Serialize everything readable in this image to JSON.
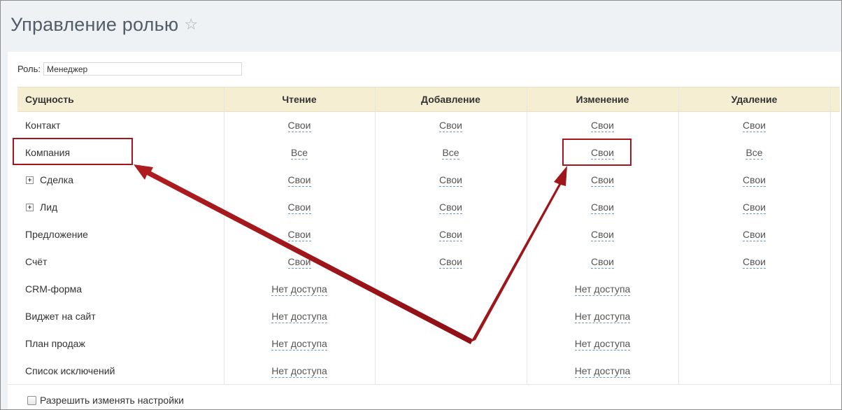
{
  "header": {
    "title": "Управление ролью"
  },
  "role": {
    "label": "Роль:",
    "value": "Менеджер"
  },
  "table": {
    "columns": [
      "Сущность",
      "Чтение",
      "Добавление",
      "Изменение",
      "Удаление"
    ],
    "rows": [
      {
        "entity": "Контакт",
        "expandable": false,
        "cells": [
          "Свои",
          "Свои",
          "Свои",
          "Свои"
        ]
      },
      {
        "entity": "Компания",
        "expandable": false,
        "cells": [
          "Все",
          "Все",
          "Свои",
          "Все"
        ]
      },
      {
        "entity": "Сделка",
        "expandable": true,
        "cells": [
          "Свои",
          "Свои",
          "Свои",
          "Свои"
        ]
      },
      {
        "entity": "Лид",
        "expandable": true,
        "cells": [
          "Свои",
          "Свои",
          "Свои",
          "Свои"
        ]
      },
      {
        "entity": "Предложение",
        "expandable": false,
        "cells": [
          "Свои",
          "Свои",
          "Свои",
          "Свои"
        ]
      },
      {
        "entity": "Счёт",
        "expandable": false,
        "cells": [
          "Свои",
          "Свои",
          "Свои",
          "Свои"
        ]
      },
      {
        "entity": "CRM-форма",
        "expandable": false,
        "cells": [
          "Нет доступа",
          "",
          "Нет доступа",
          ""
        ]
      },
      {
        "entity": "Виджет на сайт",
        "expandable": false,
        "cells": [
          "Нет доступа",
          "",
          "Нет доступа",
          ""
        ]
      },
      {
        "entity": "План продаж",
        "expandable": false,
        "cells": [
          "Нет доступа",
          "",
          "Нет доступа",
          ""
        ]
      },
      {
        "entity": "Список исключений",
        "expandable": false,
        "cells": [
          "Нет доступа",
          "",
          "Нет доступа",
          ""
        ]
      }
    ]
  },
  "footer": {
    "checkbox_label": "Разрешить изменять настройки",
    "checked": false
  },
  "annotations": {
    "highlight_color": "#a4161c",
    "highlighted": [
      "Компания",
      "Компания / Изменение"
    ]
  }
}
